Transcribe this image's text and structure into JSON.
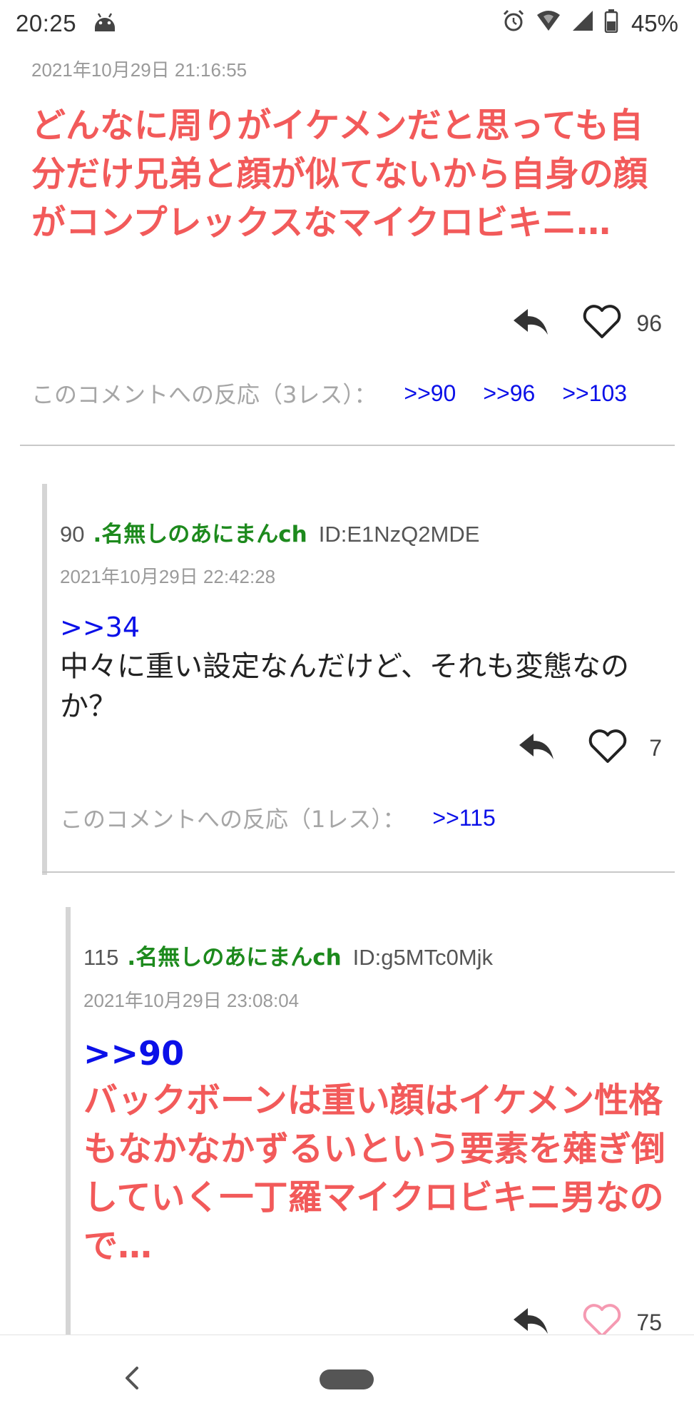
{
  "status_bar": {
    "time": "20:25",
    "battery": "45%",
    "icons": [
      "android-debug-icon",
      "alarm-icon",
      "wifi-icon",
      "signal-icon",
      "battery-icon"
    ]
  },
  "posts": [
    {
      "date": "2021年10月29日 21:16:55",
      "body": "どんなに周りがイケメンだと思っても自分だけ兄弟と顔が似てないから自身の顔がコンプレックスなマイクロビキニ…",
      "likes": "96",
      "reactions_label": "このコメントへの反応（3レス）：",
      "reactions": [
        ">>90",
        ">>96",
        ">>103"
      ]
    },
    {
      "number": "90",
      "name": ".名無しのあにまんch",
      "id": "ID:E1NzQ2MDE",
      "date": "2021年10月29日 22:42:28",
      "anchor": ">>34",
      "body": "中々に重い設定なんだけど、それも変態なのか？",
      "likes": "7",
      "reactions_label": "このコメントへの反応（1レス）：",
      "reactions": [
        ">>115"
      ]
    },
    {
      "number": "115",
      "name": ".名無しのあにまんch",
      "id": "ID:g5MTc0Mjk",
      "date": "2021年10月29日 23:08:04",
      "anchor": ">>90",
      "body": "バックボーンは重い顔はイケメン性格もなかなかずるいという要素を薙ぎ倒していく一丁羅マイクロビキニ男なので…",
      "likes": "75"
    }
  ],
  "colors": {
    "highlight_red": "#f25a5a",
    "anchor_blue": "#0b10e8",
    "name_green": "#1d8a1d",
    "heart_pink": "#f59ab2"
  }
}
